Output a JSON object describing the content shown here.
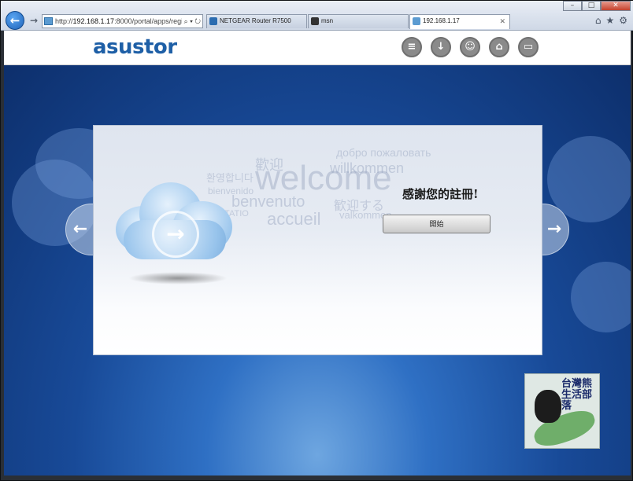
{
  "browser": {
    "url_prefix": "http://",
    "url_host": "192.168.1.17",
    "url_rest": ":8000/portal/apps/regi",
    "address_tools": "⌕ ▾ ↻",
    "tabs": [
      {
        "label": "NETGEAR Router R7500",
        "icon_color": "#2b6cb0"
      },
      {
        "label": "msn",
        "icon_color": "#333333"
      },
      {
        "label": "192.168.1.17",
        "icon_color": "#5b9bd1",
        "active": true
      }
    ],
    "window_buttons": [
      "–",
      "□",
      "✕"
    ]
  },
  "site": {
    "logo": "asustor",
    "header_icons": [
      "chat-icon",
      "download-icon",
      "support-icon",
      "bank-icon",
      "menu-icon"
    ]
  },
  "welcome_words": [
    {
      "text": "welcome",
      "size": 44
    },
    {
      "text": "歡迎",
      "size": 18
    },
    {
      "text": "добро пожаловать",
      "size": 14
    },
    {
      "text": "willkommen",
      "size": 18
    },
    {
      "text": "환영합니다",
      "size": 13
    },
    {
      "text": "bienvenido",
      "size": 12
    },
    {
      "text": "benvenuto",
      "size": 20
    },
    {
      "text": "accueil",
      "size": 22
    },
    {
      "text": "歓迎する",
      "size": 16
    },
    {
      "text": "valkommen",
      "size": 13
    },
    {
      "text": "ITATIO",
      "size": 11
    }
  ],
  "main": {
    "heading": "感謝您的註冊!",
    "start_button": "開始",
    "prev_arrow": "←",
    "next_arrow": "→",
    "cloud_arrow": "→"
  },
  "watermark": {
    "title": "台灣熊 生活部落"
  },
  "colors": {
    "brand": "#1e5fa6",
    "background": "#184a98"
  }
}
